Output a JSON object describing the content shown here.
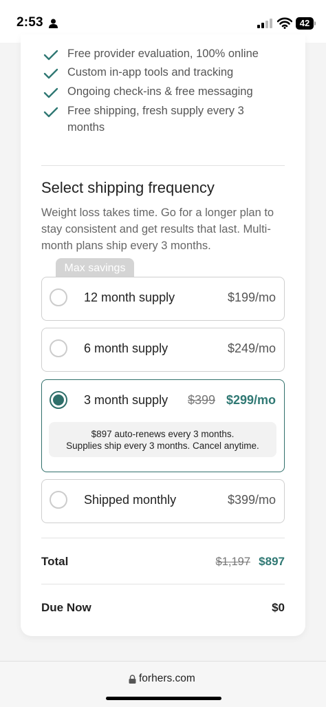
{
  "status": {
    "time": "2:53",
    "battery": "42"
  },
  "benefits": [
    {
      "text": "Free provider evaluation, 100% online"
    },
    {
      "text": "Custom in-app tools and tracking"
    },
    {
      "text": "Ongoing check-ins & free messaging"
    },
    {
      "text": "Free shipping, fresh supply every 3 months"
    }
  ],
  "shipping": {
    "title": "Select shipping frequency",
    "description": "Weight loss takes time. Go for a longer plan to stay consistent and get results that last. Multi-month plans ship every 3 months.",
    "savings_tag": "Max savings",
    "options": [
      {
        "label": "12 month supply",
        "price": "$199/mo"
      },
      {
        "label": "6 month supply",
        "price": "$249/mo"
      },
      {
        "label": "3 month supply",
        "old_price": "$399",
        "price": "$299/mo",
        "selected": true,
        "note_line1": "$897 auto-renews every 3 months.",
        "note_line2": "Supplies ship every 3 months. Cancel anytime."
      },
      {
        "label": "Shipped monthly",
        "price": "$399/mo"
      }
    ]
  },
  "summary": {
    "total_label": "Total",
    "total_old": "$1,197",
    "total_value": "$897",
    "due_label": "Due Now",
    "due_value": "$0"
  },
  "browser": {
    "url": "forhers.com"
  },
  "colors": {
    "accent": "#2f6f6a",
    "accent_text": "#2f7873"
  }
}
